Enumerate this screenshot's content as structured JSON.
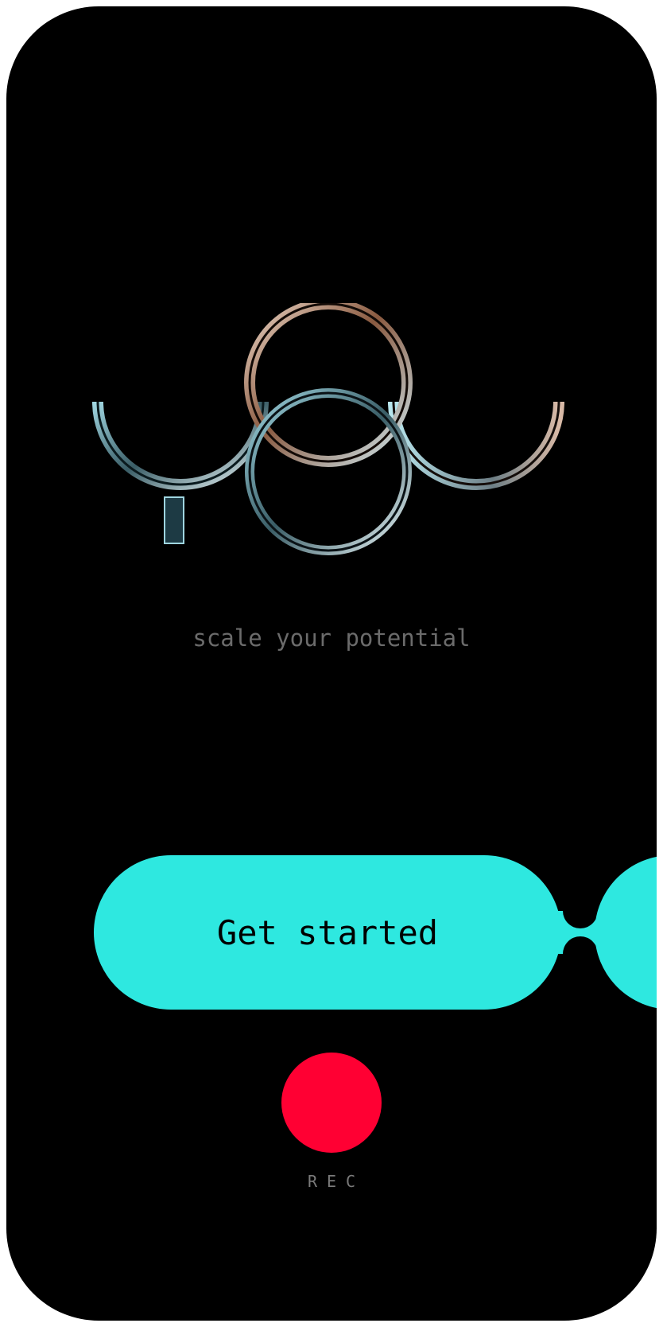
{
  "tagline": "scale your potential",
  "cta": {
    "label": "Get started",
    "color": "#2ee8e0"
  },
  "rec": {
    "label": "REC",
    "color": "#ff0033"
  },
  "logo": {
    "icon": "logo-rings-icon"
  }
}
